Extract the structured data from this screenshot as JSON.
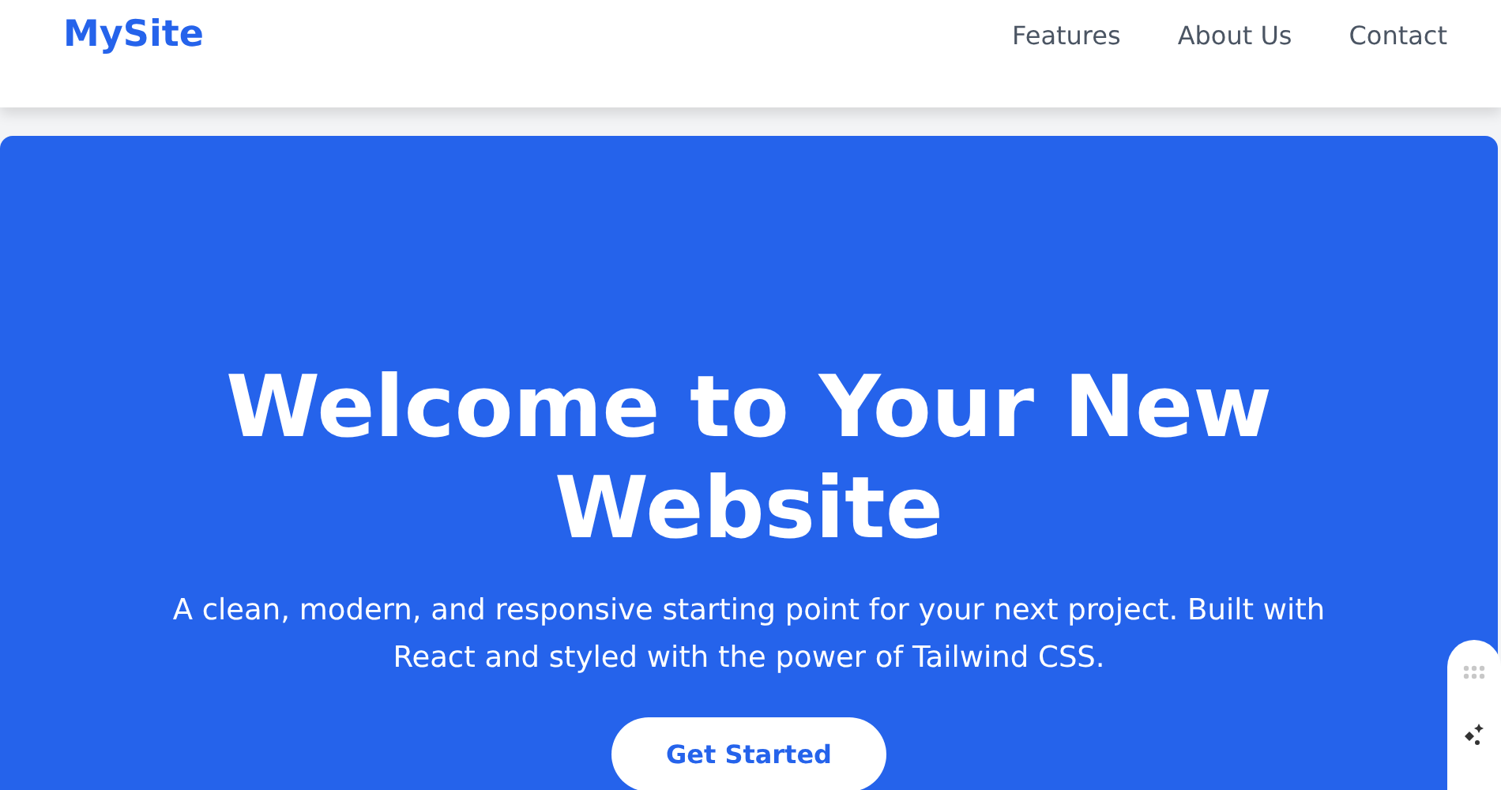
{
  "header": {
    "logo": "MySite",
    "nav": [
      {
        "label": "Features"
      },
      {
        "label": "About Us"
      },
      {
        "label": "Contact"
      }
    ]
  },
  "hero": {
    "title": "Welcome to Your New Website",
    "subtitle": "A clean, modern, and responsive starting point for your next project. Built with React and styled with the power of Tailwind CSS.",
    "button": "Get Started"
  }
}
